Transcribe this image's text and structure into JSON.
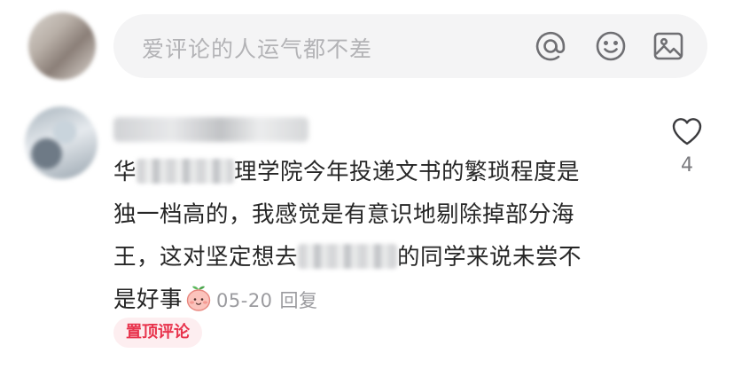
{
  "input_bar": {
    "placeholder": "爱评论的人运气都不差",
    "icons": [
      "at-icon",
      "emoji-icon",
      "image-icon"
    ]
  },
  "comment": {
    "lines": [
      [
        "华",
        "",
        "理学院今年投递文书的繁琐程度是"
      ],
      [
        "独一档高的，我感觉是有意识地剔除掉部分海"
      ],
      [
        "王，这对坚定想去",
        "",
        "的同学来说未尝不"
      ],
      [
        "是好事"
      ]
    ],
    "emoji": "peach-face-emoji",
    "date": "05-20",
    "reply_label": "回复",
    "like_icon": "heart-outline-icon",
    "like_count": "4",
    "pinned_badge": "置顶评论"
  },
  "colors": {
    "accent": "#e8334c",
    "text": "#262626",
    "muted": "#9b9b9f",
    "input_bg": "#f4f4f5"
  }
}
